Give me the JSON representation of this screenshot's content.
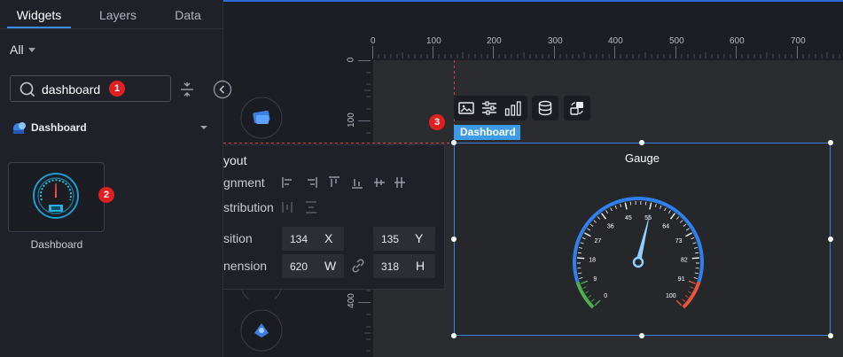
{
  "tabs": [
    {
      "label": "Widgets",
      "active": true
    },
    {
      "label": "Layers",
      "active": false
    },
    {
      "label": "Data",
      "active": false
    }
  ],
  "filter": {
    "label": "All"
  },
  "search": {
    "value": "dashboard",
    "badge": "1"
  },
  "category": {
    "label": "Dashboard"
  },
  "widget_item": {
    "label": "Dashboard",
    "badge": "2"
  },
  "ruler": {
    "x_ticks": [
      "0",
      "100",
      "200",
      "300",
      "400",
      "500",
      "600",
      "700"
    ],
    "y_ticks": [
      "0",
      "100",
      "400"
    ]
  },
  "toolbar": {
    "badge": "3",
    "tag": "Dashboard"
  },
  "gauge": {
    "title": "Gauge",
    "ticks": [
      "0",
      "9",
      "18",
      "27",
      "36",
      "45",
      "55",
      "64",
      "73",
      "82",
      "91",
      "100"
    ],
    "value": 55,
    "colors": {
      "main": "#2f80ed",
      "low": "#4caf50",
      "high": "#e8553b"
    }
  },
  "layout_panel": {
    "title": "yout",
    "alignment_label": "gnment",
    "distribution_label": "stribution",
    "position_label": "sition",
    "dimension_label": "nension",
    "x_value": "134",
    "x_unit": "X",
    "y_value": "135",
    "y_unit": "Y",
    "w_value": "620",
    "w_unit": "W",
    "h_value": "318",
    "h_unit": "H"
  },
  "colors": {
    "accent": "#3b8cff",
    "tag": "#3d9bea",
    "badge": "#e02020"
  }
}
